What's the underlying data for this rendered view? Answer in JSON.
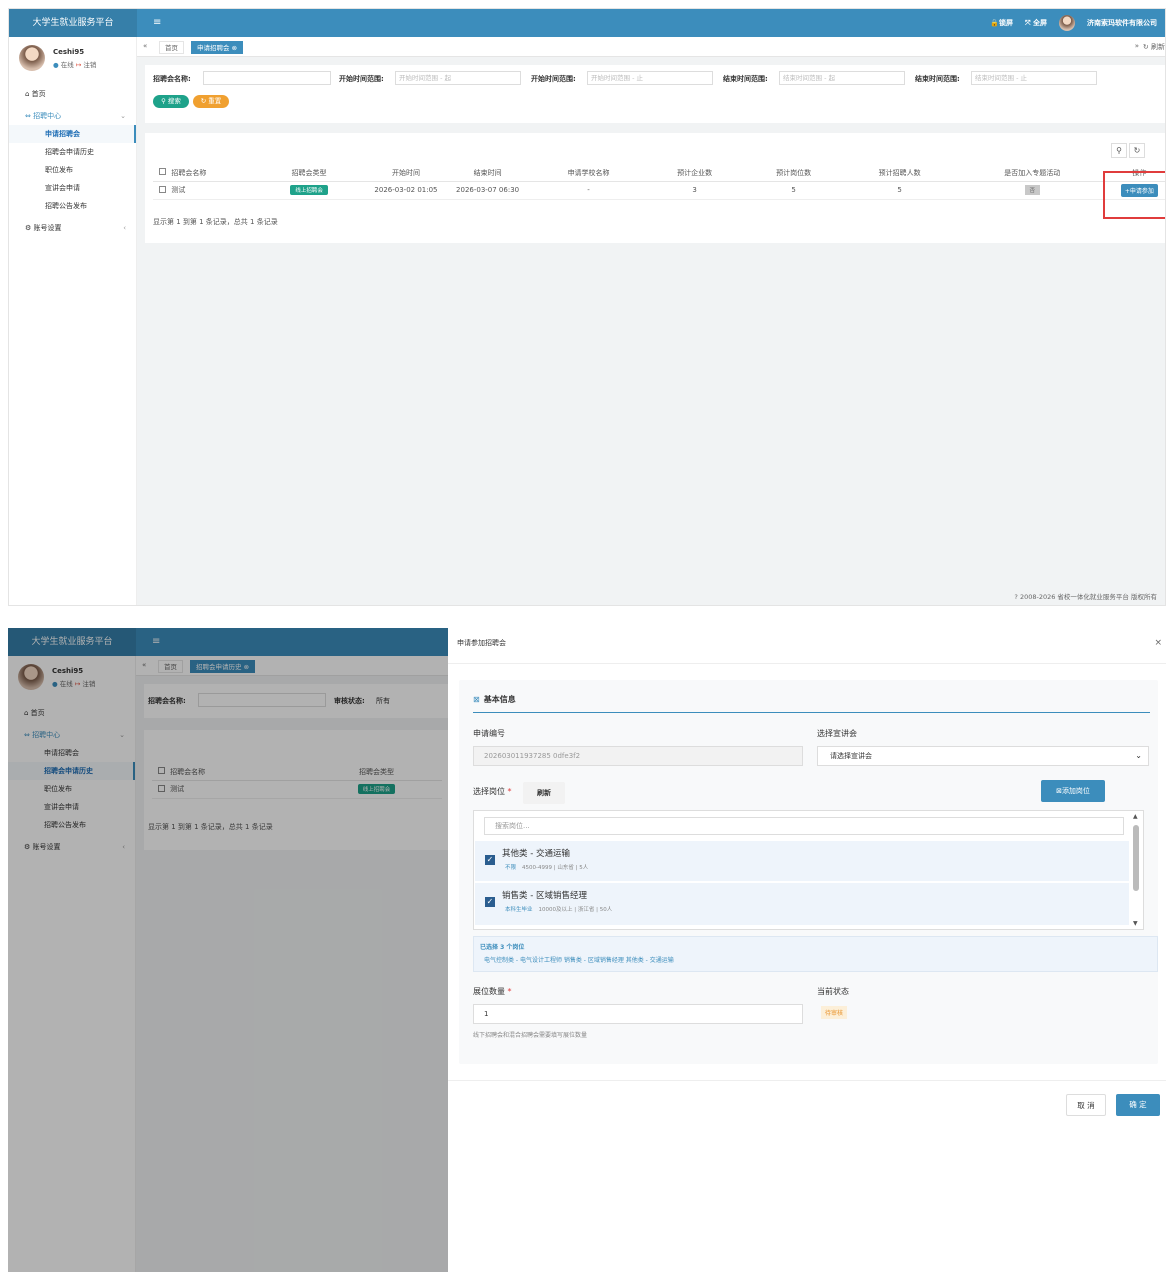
{
  "app": {
    "title": "大学生就业服务平台",
    "menu_icon": "≡"
  },
  "header": {
    "lock": "锁屏",
    "fullscreen": "全屏",
    "company": "济南索玛软件有限公司"
  },
  "user": {
    "name": "Ceshi95",
    "online": "在线",
    "logout": "注销"
  },
  "sidebar": {
    "home": "首页",
    "recruit_center": "招聘中心",
    "items": [
      "申请招聘会",
      "招聘会申请历史",
      "职位发布",
      "宣讲会申请",
      "招聘公告发布"
    ],
    "account": "账号设置"
  },
  "screen1": {
    "tabs": {
      "home": "首页",
      "active": "申请招聘会",
      "refresh": "刷新"
    },
    "filters": {
      "name_label": "招聘会名称:",
      "start_range_label": "开始时间范围:",
      "start_from_ph": "开始时间范围 - 起",
      "start_to_ph": "开始时间范围 - 止",
      "end_range_label": "结束时间范围:",
      "end_from_ph": "结束时间范围 - 起",
      "end_to_ph": "结束时间范围 - 止",
      "search": "搜索",
      "reset": "重置"
    },
    "table": {
      "columns": [
        "招聘会名称",
        "招聘会类型",
        "开始时间",
        "结束时间",
        "申请学校名称",
        "预计企业数",
        "预计岗位数",
        "预计招聘人数",
        "是否加入专题活动",
        "操作"
      ],
      "rows": [
        {
          "name": "测试",
          "type": "线上招聘会",
          "start": "2026-03-02 01:05",
          "end": "2026-03-07 06:30",
          "school": "-",
          "companies": "3",
          "positions": "5",
          "people": "5",
          "special": "否",
          "action": "+申请参加"
        }
      ],
      "summary": "显示第 1 到第 1 条记录，总共 1 条记录"
    },
    "footer": "? 2008-2026 省校一体化就业服务平台 版权所有"
  },
  "screen2": {
    "tabs": {
      "home": "首页",
      "active": "招聘会申请历史"
    },
    "filters": {
      "name_label": "招聘会名称:",
      "status_label": "审核状态:",
      "status_value": "所有"
    },
    "table": {
      "columns": [
        "招聘会名称",
        "招聘会类型"
      ],
      "rows": [
        {
          "name": "测试",
          "type": "线上招聘会"
        }
      ],
      "summary": "显示第 1 到第 1 条记录，总共 1 条记录"
    },
    "modal": {
      "title": "申请参加招聘会",
      "section": "基本信息",
      "apply_no_label": "申请编号",
      "apply_no": "202603011937285 0dfe3f2",
      "talk_label": "选择宣讲会",
      "talk_value": "请选择宣讲会",
      "position_label": "选择岗位",
      "refresh": "刷新",
      "add_position": "添加岗位",
      "search_ph": "搜索岗位...",
      "positions": [
        {
          "title": "其他类 - 交通运输",
          "tag": "不限",
          "detail": "4500-4999 | 山东省 | 5人"
        },
        {
          "title": "销售类 - 区域销售经理",
          "tag": "本科生毕业",
          "detail": "10000及以上 | 浙江省 | 50人"
        }
      ],
      "selected_count": "已选择 3 个岗位",
      "selected_list": "电气控制类 - 电气设计工程师    销售类 - 区域销售经理    其他类 - 交通运输",
      "booth_label": "展位数量",
      "booth_value": "1",
      "booth_hint": "线下招聘会和混合招聘会需要填写展位数量",
      "status_label": "当前状态",
      "status_value": "待审核",
      "cancel": "取 消",
      "confirm": "确 定"
    }
  }
}
